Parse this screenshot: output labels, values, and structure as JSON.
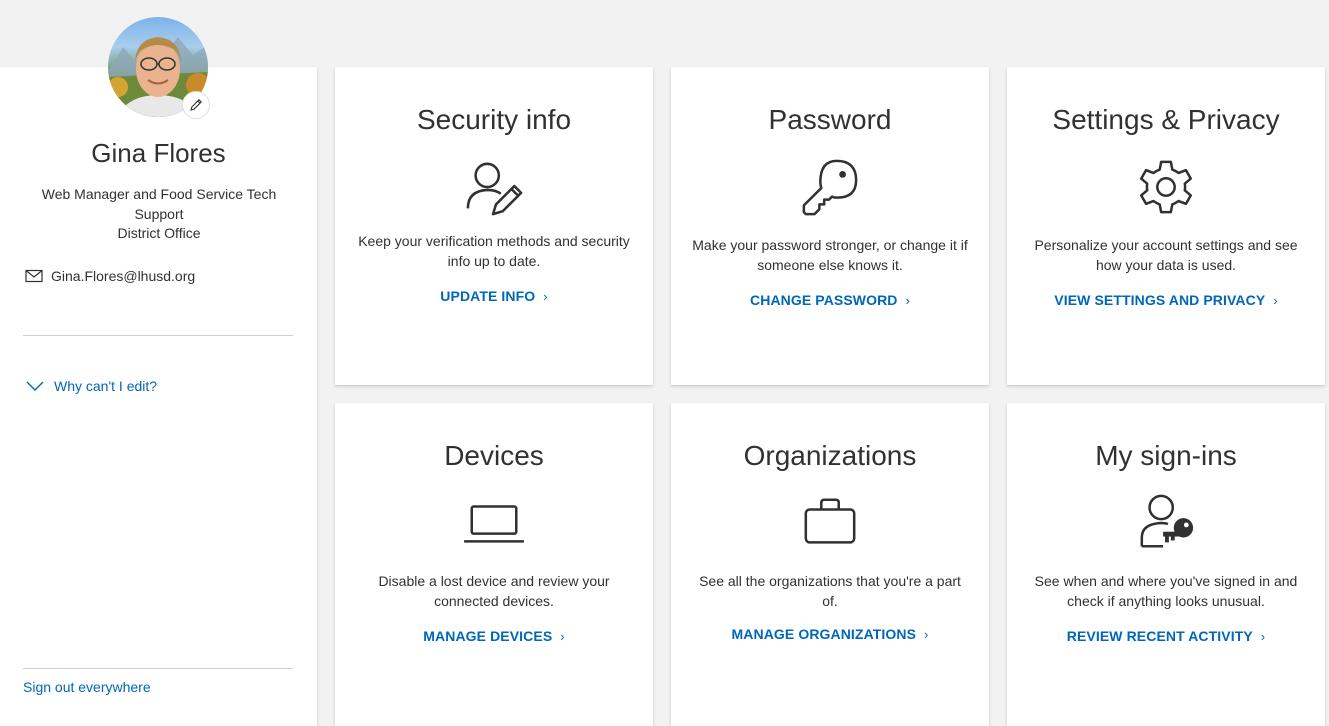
{
  "profile": {
    "name": "Gina Flores",
    "job_line1": "Web Manager and Food Service Tech",
    "job_line2": "Support",
    "job_line3": "District Office",
    "email": "Gina.Flores@lhusd.org",
    "why_cant_edit": "Why can't I edit?",
    "sign_out": "Sign out everywhere",
    "avatar_icon": "user-photo",
    "edit_icon": "pencil-icon"
  },
  "tiles": [
    {
      "title": "Security info",
      "icon": "user-edit-icon",
      "desc_line1": "Keep your verification methods and security",
      "desc_line2": "info up to date.",
      "link": "UPDATE INFO"
    },
    {
      "title": "Password",
      "icon": "key-icon",
      "desc_line1": "Make your password stronger, or change it if",
      "desc_line2": "someone else knows it.",
      "link": "CHANGE PASSWORD"
    },
    {
      "title": "Settings & Privacy",
      "icon": "gear-icon",
      "desc_line1": "Personalize your account settings and see",
      "desc_line2": "how your data is used.",
      "link": "VIEW SETTINGS AND PRIVACY"
    },
    {
      "title": "Devices",
      "icon": "laptop-icon",
      "desc_line1": "Disable a lost device and review your",
      "desc_line2": "connected devices.",
      "link": "MANAGE DEVICES"
    },
    {
      "title": "Organizations",
      "icon": "briefcase-icon",
      "desc_line1": "See all the organizations that you're a part of.",
      "desc_line2": "",
      "link": "MANAGE ORGANIZATIONS"
    },
    {
      "title": "My sign-ins",
      "icon": "user-key-icon",
      "desc_line1": "See when and where you've signed in and",
      "desc_line2": "check if anything looks unusual.",
      "link": "REVIEW RECENT ACTIVITY"
    }
  ],
  "colors": {
    "link": "#0067b8",
    "text": "#323130",
    "background": "#f2f2f2",
    "card": "#ffffff"
  }
}
